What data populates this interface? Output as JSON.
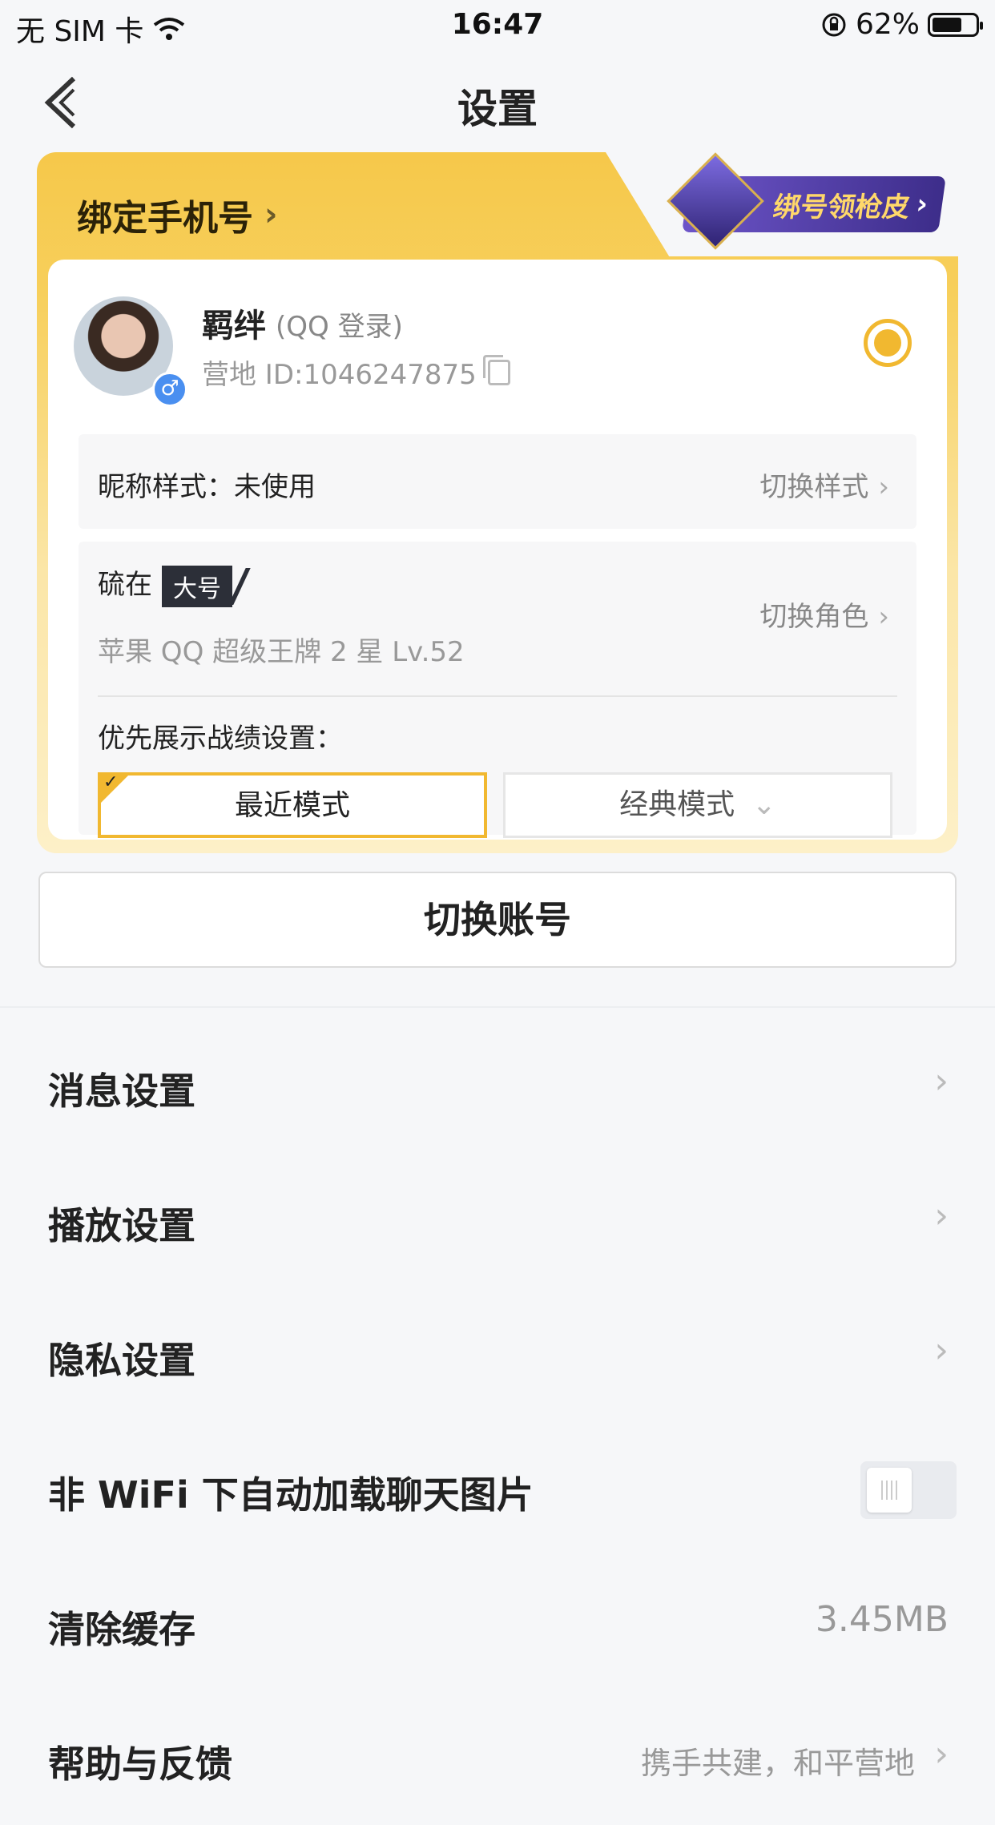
{
  "status_bar": {
    "carrier": "无 SIM 卡",
    "time": "16:47",
    "battery": "62%",
    "battery_level": 0.62
  },
  "nav": {
    "title": "设置"
  },
  "account_card": {
    "bind_phone": "绑定手机号",
    "promo": "绑号领枪皮",
    "username": "羁绊",
    "login_type": "(QQ 登录)",
    "camp_id": "营地 ID:1046247875",
    "nickname_style_label": "昵称样式：未使用",
    "nickname_style_action": "切换样式",
    "role_prefix": "硫在",
    "role_tag": "大号",
    "role_info": "苹果 QQ  超级王牌 2 星  Lv.52",
    "role_action": "切换角色",
    "pref_label": "优先展示战绩设置：",
    "mode_recent": "最近模式",
    "mode_classic": "经典模式",
    "accent_color": "#f1b830"
  },
  "switch_account": "切换账号",
  "settings": [
    {
      "label": "消息设置"
    },
    {
      "label": "播放设置"
    },
    {
      "label": "隐私设置"
    },
    {
      "label": "非 WiFi 下自动加载聊天图片",
      "toggle": false
    },
    {
      "label": "清除缓存",
      "value": "3.45MB"
    },
    {
      "label": "帮助与反馈",
      "value": "携手共建，和平营地"
    }
  ]
}
